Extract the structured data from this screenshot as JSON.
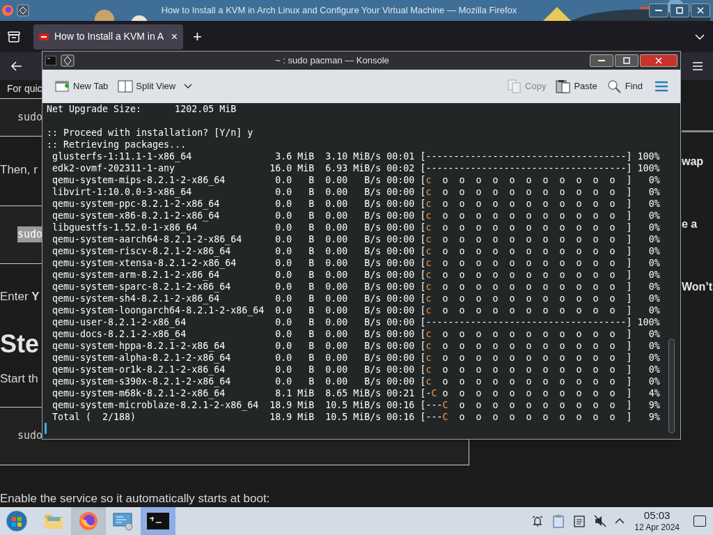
{
  "browser": {
    "title": "How to Install a KVM in Arch Linux and Configure Your Virtual Machine — Mozilla Firefox",
    "tabs": [
      {
        "title": "How to Install a KVM in A",
        "close": "×",
        "selected": true
      }
    ],
    "new_tab": "+"
  },
  "page": {
    "blocks": [
      {
        "kind": "banner",
        "text": "For quic"
      },
      {
        "kind": "code",
        "text": "sudo",
        "highlighted": false
      },
      {
        "kind": "text",
        "text": "Then, r"
      },
      {
        "kind": "code",
        "text": "sudo",
        "highlighted": true
      },
      {
        "kind": "text",
        "text": "Enter **Y**"
      },
      {
        "kind": "heading",
        "text": "Ste"
      },
      {
        "kind": "text",
        "text": "Start th"
      },
      {
        "kind": "code",
        "text": "sudo",
        "highlighted": false
      },
      {
        "kind": "text",
        "text": "Enable the service so it automatically starts at boot:"
      }
    ],
    "aside": [
      {
        "kind": "rule"
      },
      {
        "kind": "text",
        "text": "wap"
      },
      {
        "kind": "text",
        "text": "e a"
      },
      {
        "kind": "text",
        "text": "Won’t"
      }
    ]
  },
  "konsole": {
    "title": "~ : sudo pacman — Konsole",
    "toolbar": [
      {
        "label": "New Tab",
        "disabled": false
      },
      {
        "label": "Split View",
        "disabled": false
      },
      {
        "label": "Copy",
        "disabled": true
      },
      {
        "label": "Paste",
        "disabled": false
      },
      {
        "label": "Find",
        "disabled": false
      }
    ],
    "lines": [
      {
        "kind": "text",
        "text": "Net Upgrade Size:      1202.05 MiB"
      },
      {
        "kind": "blank"
      },
      {
        "kind": "text",
        "text": ":: Proceed with installation? [Y/n] y"
      },
      {
        "kind": "text",
        "text": ":: Retrieving packages..."
      }
    ],
    "downloads": [
      {
        "name": "glusterfs-1:11.1-1-x86_64",
        "size": "3.6 MiB",
        "rate": "3.10 MiB/s",
        "eta": "00:01",
        "done": "[------------------------------------]",
        "percent": "100%"
      },
      {
        "name": "edk2-ovmf-202311-1-any",
        "size": "16.0 MiB",
        "rate": "6.93 MiB/s",
        "eta": "00:02",
        "done": "[------------------------------------]",
        "percent": "100%"
      },
      {
        "name": "qemu-system-mips-8.2.1-2-x86_64",
        "size": "0.0   B",
        "rate": "0.00   B/s",
        "eta": "00:00",
        "done": "[",
        "head": "c",
        "rest": "  o  o  o  o  o  o  o  o  o  o  o  ]",
        "percent": "0%"
      },
      {
        "name": "libvirt-1:10.0.0-3-x86_64",
        "size": "0.0   B",
        "rate": "0.00   B/s",
        "eta": "00:00",
        "done": "[",
        "head": "c",
        "rest": "  o  o  o  o  o  o  o  o  o  o  o  ]",
        "percent": "0%"
      },
      {
        "name": "qemu-system-ppc-8.2.1-2-x86_64",
        "size": "0.0   B",
        "rate": "0.00   B/s",
        "eta": "00:00",
        "done": "[",
        "head": "c",
        "rest": "  o  o  o  o  o  o  o  o  o  o  o  ]",
        "percent": "0%"
      },
      {
        "name": "qemu-system-x86-8.2.1-2-x86_64",
        "size": "0.0   B",
        "rate": "0.00   B/s",
        "eta": "00:00",
        "done": "[",
        "head": "c",
        "rest": "  o  o  o  o  o  o  o  o  o  o  o  ]",
        "percent": "0%"
      },
      {
        "name": "libguestfs-1.52.0-1-x86_64",
        "size": "0.0   B",
        "rate": "0.00   B/s",
        "eta": "00:00",
        "done": "[",
        "head": "c",
        "rest": "  o  o  o  o  o  o  o  o  o  o  o  ]",
        "percent": "0%"
      },
      {
        "name": "qemu-system-aarch64-8.2.1-2-x86_64",
        "size": "0.0   B",
        "rate": "0.00   B/s",
        "eta": "00:00",
        "done": "[",
        "head": "c",
        "rest": "  o  o  o  o  o  o  o  o  o  o  o  ]",
        "percent": "0%"
      },
      {
        "name": "qemu-system-riscv-8.2.1-2-x86_64",
        "size": "0.0   B",
        "rate": "0.00   B/s",
        "eta": "00:00",
        "done": "[",
        "head": "c",
        "rest": "  o  o  o  o  o  o  o  o  o  o  o  ]",
        "percent": "0%"
      },
      {
        "name": "qemu-system-xtensa-8.2.1-2-x86_64",
        "size": "0.0   B",
        "rate": "0.00   B/s",
        "eta": "00:00",
        "done": "[",
        "head": "c",
        "rest": "  o  o  o  o  o  o  o  o  o  o  o  ]",
        "percent": "0%"
      },
      {
        "name": "qemu-system-arm-8.2.1-2-x86_64",
        "size": "0.0   B",
        "rate": "0.00   B/s",
        "eta": "00:00",
        "done": "[",
        "head": "c",
        "rest": "  o  o  o  o  o  o  o  o  o  o  o  ]",
        "percent": "0%"
      },
      {
        "name": "qemu-system-sparc-8.2.1-2-x86_64",
        "size": "0.0   B",
        "rate": "0.00   B/s",
        "eta": "00:00",
        "done": "[",
        "head": "c",
        "rest": "  o  o  o  o  o  o  o  o  o  o  o  ]",
        "percent": "0%"
      },
      {
        "name": "qemu-system-sh4-8.2.1-2-x86_64",
        "size": "0.0   B",
        "rate": "0.00   B/s",
        "eta": "00:00",
        "done": "[",
        "head": "c",
        "rest": "  o  o  o  o  o  o  o  o  o  o  o  ]",
        "percent": "0%"
      },
      {
        "name": "qemu-system-loongarch64-8.2.1-2-x86_64",
        "size": "0.0   B",
        "rate": "0.00   B/s",
        "eta": "00:00",
        "done": "[",
        "head": "c",
        "rest": "  o  o  o  o  o  o  o  o  o  o  o  ]",
        "percent": "0%"
      },
      {
        "name": "qemu-user-8.2.1-2-x86_64",
        "size": "0.0   B",
        "rate": "0.00   B/s",
        "eta": "00:00",
        "done": "[------------------------------------]",
        "percent": "100%"
      },
      {
        "name": "qemu-docs-8.2.1-2-x86_64",
        "size": "0.0   B",
        "rate": "0.00   B/s",
        "eta": "00:00",
        "done": "[",
        "head": "c",
        "rest": "  o  o  o  o  o  o  o  o  o  o  o  ]",
        "percent": "0%"
      },
      {
        "name": "qemu-system-hppa-8.2.1-2-x86_64",
        "size": "0.0   B",
        "rate": "0.00   B/s",
        "eta": "00:00",
        "done": "[",
        "head": "c",
        "rest": "  o  o  o  o  o  o  o  o  o  o  o  ]",
        "percent": "0%"
      },
      {
        "name": "qemu-system-alpha-8.2.1-2-x86_64",
        "size": "0.0   B",
        "rate": "0.00   B/s",
        "eta": "00:00",
        "done": "[",
        "head": "c",
        "rest": "  o  o  o  o  o  o  o  o  o  o  o  ]",
        "percent": "0%"
      },
      {
        "name": "qemu-system-or1k-8.2.1-2-x86_64",
        "size": "0.0   B",
        "rate": "0.00   B/s",
        "eta": "00:00",
        "done": "[",
        "head": "c",
        "rest": "  o  o  o  o  o  o  o  o  o  o  o  ]",
        "percent": "0%"
      },
      {
        "name": "qemu-system-s390x-8.2.1-2-x86_64",
        "size": "0.0   B",
        "rate": "0.00   B/s",
        "eta": "00:00",
        "done": "[",
        "head": "c",
        "rest": "  o  o  o  o  o  o  o  o  o  o  o  ]",
        "percent": "0%"
      },
      {
        "name": "qemu-system-m68k-8.2.1-2-x86_64",
        "size": "8.1 MiB",
        "rate": "8.65 MiB/s",
        "eta": "00:21",
        "done": "[-",
        "head": "C",
        "rest": " o  o  o  o  o  o  o  o  o  o  o  ]",
        "percent": "4%"
      },
      {
        "name": "qemu-system-microblaze-8.2.1-2-x86_64",
        "size": "18.9 MiB",
        "rate": "10.5 MiB/s",
        "eta": "00:16",
        "done": "[---",
        "head": "C",
        "rest": "  o  o  o  o  o  o  o  o  o  o  ]",
        "percent": "9%"
      },
      {
        "name": "Total (  2/188)",
        "size": "18.9 MiB",
        "rate": "10.5 MiB/s",
        "eta": "00:16",
        "done": "[---",
        "head": "C",
        "rest": "  o  o  o  o  o  o  o  o  o  o  ]",
        "percent": "9%"
      }
    ]
  },
  "taskbar": {
    "apps": [
      {
        "active": false,
        "hover": false
      },
      {
        "active": false,
        "hover": true
      },
      {
        "active": false,
        "hover": false
      },
      {
        "active": true,
        "hover": false
      }
    ],
    "time": "05:03",
    "date": "12 Apr 2024"
  }
}
